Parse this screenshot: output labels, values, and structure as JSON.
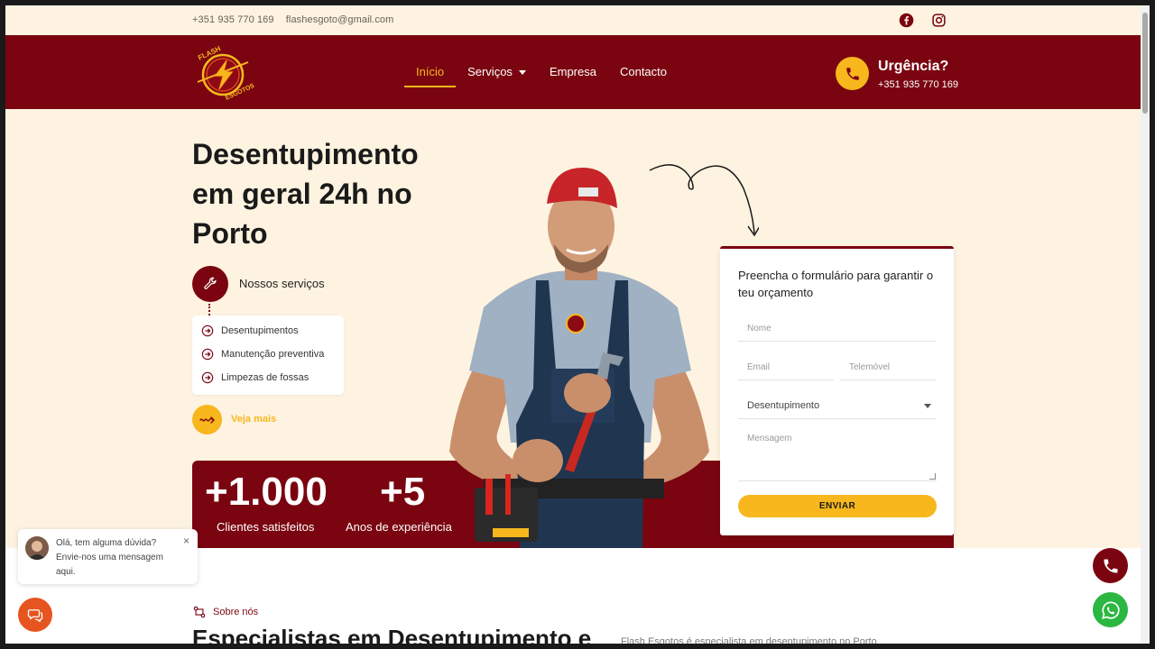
{
  "topbar": {
    "phone": "+351 935 770 169",
    "email": "flashesgoto@gmail.com",
    "social": [
      {
        "icon": "facebook-icon"
      },
      {
        "icon": "instagram-icon"
      }
    ]
  },
  "header": {
    "logo_text": "FLASH ESGOTOS",
    "nav": [
      {
        "label": "Início",
        "active": true
      },
      {
        "label": "Serviços",
        "has_dropdown": true
      },
      {
        "label": "Empresa"
      },
      {
        "label": "Contacto"
      }
    ],
    "urgency": {
      "title": "Urgência?",
      "phone": "+351 935 770 169"
    }
  },
  "hero": {
    "title": "Desentupimento em geral 24h no Porto",
    "services_label": "Nossos serviços",
    "services": [
      "Desentupimentos",
      "Manutenção preventiva",
      "Limpezas de fossas"
    ],
    "more_label": "Veja mais",
    "stats": [
      {
        "value": "+1.000",
        "label": "Clientes satisfeitos"
      },
      {
        "value": "+5",
        "label": "Anos de experiência"
      }
    ]
  },
  "form": {
    "title": "Preencha o formulário para garantir o teu orçamento",
    "name_placeholder": "Nome",
    "email_placeholder": "Email",
    "phone_placeholder": "Telemóvel",
    "select_value": "Desentupimento",
    "message_placeholder": "Mensagem",
    "submit_label": "ENVIAR"
  },
  "about": {
    "tag": "Sobre nós",
    "heading": "Especialistas em Desentupimento e",
    "text": "Flash Esgotos é especialista em desentupimento no Porto"
  },
  "chat": {
    "message": "Olá, tem alguma dúvida? Envie-nos uma mensagem aqui.",
    "close": "×"
  },
  "colors": {
    "brand_red": "#7a0510",
    "accent_yellow": "#f7b71d",
    "cream": "#fdf3e0",
    "chat_orange": "#e6541f",
    "whatsapp_green": "#2bb741"
  }
}
